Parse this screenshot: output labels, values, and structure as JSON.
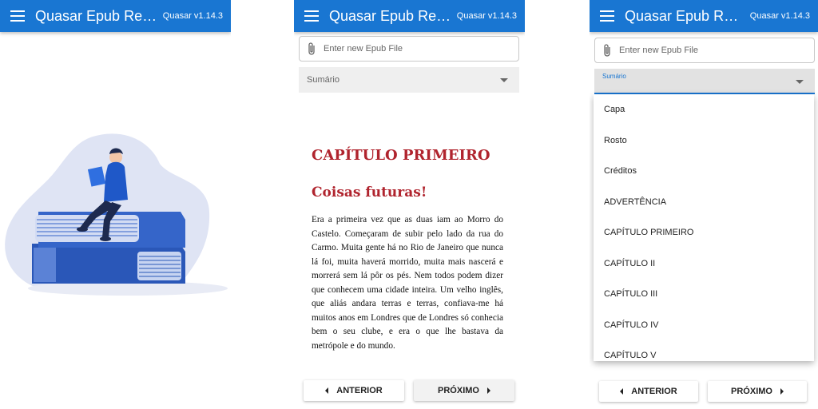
{
  "toolbar": {
    "title": "Quasar Epub Rea...",
    "version": "Quasar v1.14.3",
    "color": "#1976d2"
  },
  "file_input": {
    "placeholder": "Enter new Epub File"
  },
  "select": {
    "label": "Sumário"
  },
  "reader": {
    "chapter_title": "CAPÍTULO PRIMEIRO",
    "section_title": "Coisas futuras!",
    "paragraph": "Era a primeira vez que as duas iam ao Morro do Castelo. Começaram de subir pelo lado da rua do Carmo. Muita gente há no Rio de Janeiro que nunca lá foi, muita haverá morrido, muita mais nascerá e morrerá sem lá pôr os pés. Nem todos podem dizer que conhecem uma cidade inteira. Um velho inglês, que aliás andara terras e terras, confiava-me há muitos anos em Londres que de Londres só conhecia bem o seu clube, e era o que lhe bastava da metrópole e do mundo.",
    "heading_color": "#b0242e"
  },
  "buttons": {
    "previous": "ANTERIOR",
    "next": "PRÓXIMO"
  },
  "toc_items": [
    "Capa",
    "Rosto",
    "Créditos",
    "ADVERTÊNCIA",
    "CAPÍTULO PRIMEIRO",
    "CAPÍTULO II",
    "CAPÍTULO III",
    "CAPÍTULO IV",
    "CAPÍTULO V"
  ],
  "icons": {
    "menu": "menu-icon",
    "attach": "paperclip-icon",
    "caret": "arrow-drop-down-icon",
    "prev": "triangle-left-icon",
    "next": "triangle-right-icon"
  }
}
